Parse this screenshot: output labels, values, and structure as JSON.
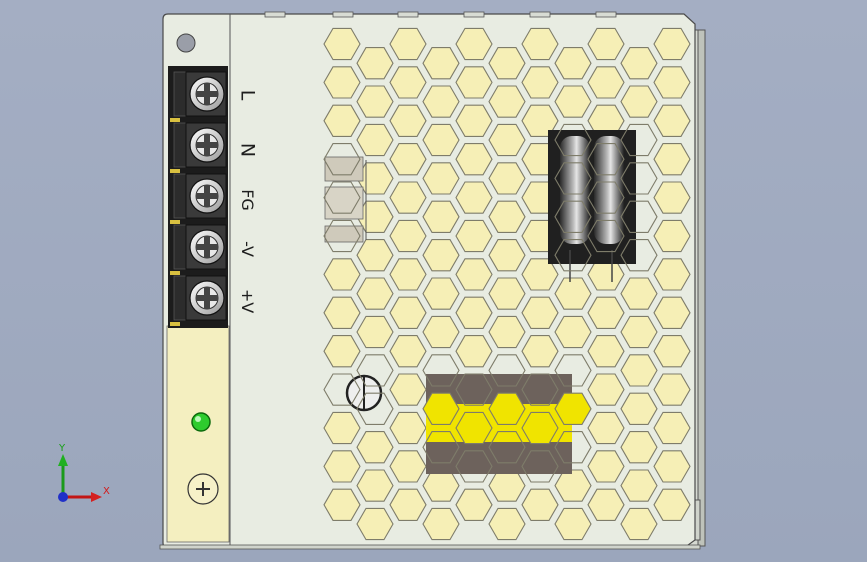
{
  "terminals": [
    {
      "label": "L"
    },
    {
      "label": "N"
    },
    {
      "label": "FG"
    },
    {
      "label": "-V"
    },
    {
      "label": "+V"
    }
  ],
  "triad": {
    "x_label": "X",
    "y_label": "Y"
  },
  "colors": {
    "background": "#a0aac0",
    "housing": "#e8ece2",
    "terminal_panel": "#f4efc0",
    "hex_cell": "#f6efb6",
    "hex_highlight": "#f0e400",
    "led": "#2ecc2e"
  }
}
